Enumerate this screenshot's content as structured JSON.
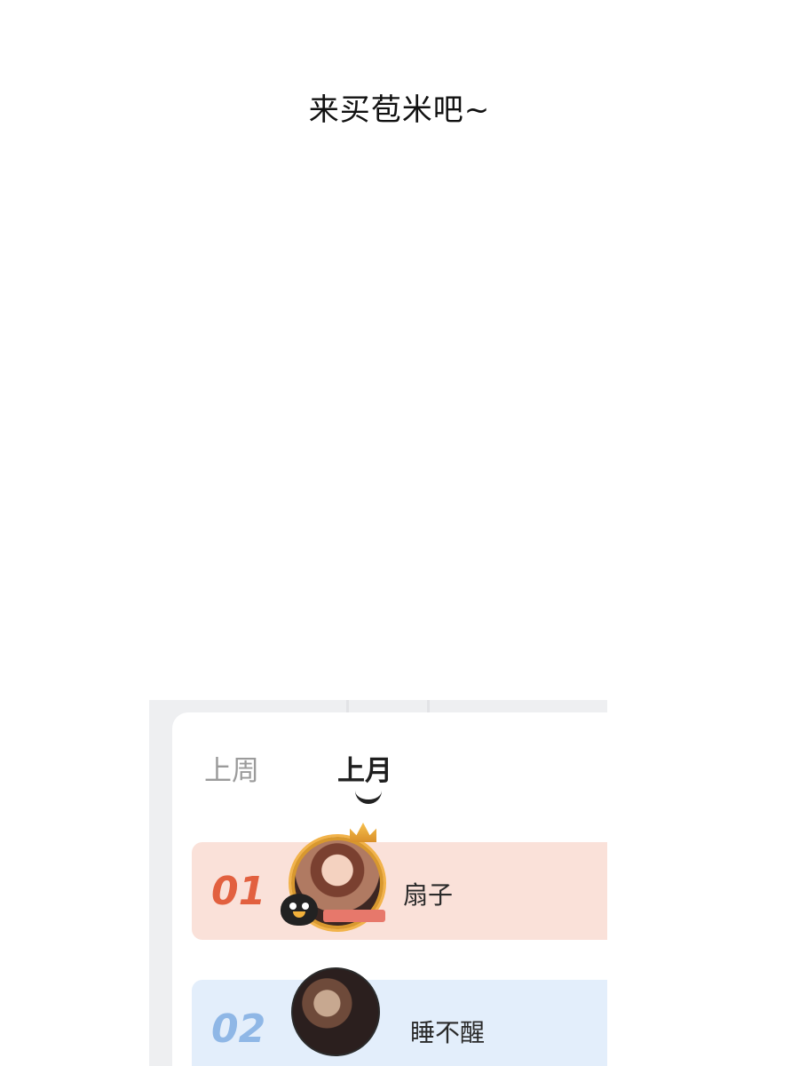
{
  "caption": "来买苞米吧~",
  "ranking_panel": {
    "tabs": [
      {
        "label": "上周",
        "active": false
      },
      {
        "label": "上月",
        "active": true
      }
    ],
    "entries": [
      {
        "rank": "01",
        "name": "扇子",
        "row_color": "#fae1d9",
        "rank_color": "#e2603f"
      },
      {
        "rank": "02",
        "name": "睡不醒",
        "row_color": "#e3eefb",
        "rank_color": "#8fb7e6"
      }
    ]
  }
}
